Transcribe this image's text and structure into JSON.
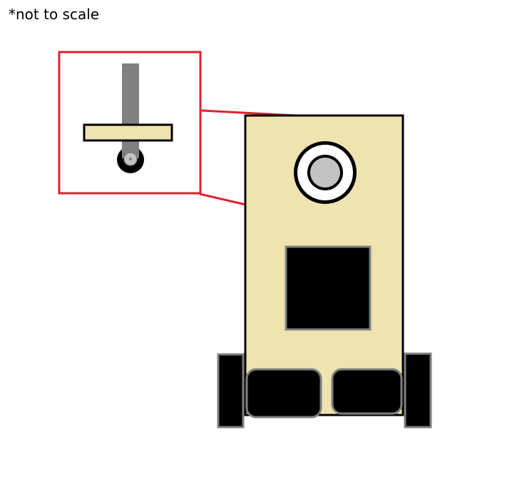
{
  "note": "*not to scale",
  "colors": {
    "body_fill": "#EFE3B0",
    "outline": "#000000",
    "callout_red": "#E02030",
    "pole_gray": "#808080",
    "hub_gray": "#C3C3C3",
    "panel_border": "#7F7F7F",
    "panel_fill": "#000000",
    "wheel_fill": "#000000",
    "wheel_border": "#7F7F7F",
    "white": "#FFFFFF"
  },
  "parts": [
    "callout-box",
    "callout-pole",
    "callout-plate",
    "callout-wheel",
    "robot-body",
    "sensor-ring",
    "screen-panel",
    "inner-wheel-left",
    "inner-wheel-right",
    "side-wheel-left",
    "side-wheel-right"
  ]
}
